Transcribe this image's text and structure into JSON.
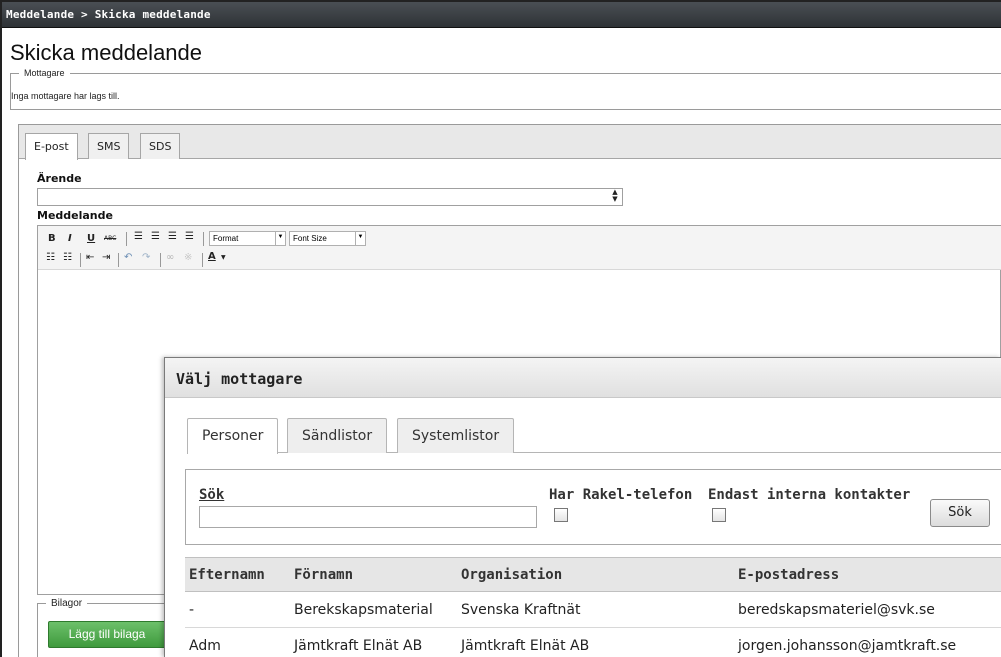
{
  "breadcrumb": "Meddelande > Skicka meddelande",
  "page_title": "Skicka meddelande",
  "recipients": {
    "legend": "Mottagare",
    "empty_text": "Inga mottagare har lags till."
  },
  "tabs": [
    {
      "label": "E-post"
    },
    {
      "label": "SMS"
    },
    {
      "label": "SDS"
    }
  ],
  "form": {
    "subject_label": "Ärende",
    "subject_value": "",
    "message_label": "Meddelande"
  },
  "toolbar": {
    "bold": "B",
    "italic": "I",
    "underline": "U",
    "strike": "ABC",
    "format_select": "Format",
    "font_size_select": "Font Size",
    "text_color": "A",
    "icons": [
      "bold-icon",
      "italic-icon",
      "underline-icon",
      "strikethrough-icon",
      "align-left-icon",
      "align-center-icon",
      "align-right-icon",
      "justify-icon",
      "bullet-list-icon",
      "numbered-list-icon",
      "outdent-icon",
      "indent-icon",
      "undo-icon",
      "redo-icon",
      "link-icon",
      "unlink-icon",
      "text-color-icon"
    ]
  },
  "attachments": {
    "legend": "Bilagor",
    "add_button": "Lägg till bilaga"
  },
  "modal": {
    "title": "Välj mottagare",
    "tabs": [
      {
        "label": "Personer"
      },
      {
        "label": "Sändlistor"
      },
      {
        "label": "Systemlistor"
      }
    ],
    "search": {
      "label": "Sök",
      "value": "",
      "rakel_label": "Har Rakel-telefon",
      "internal_label": "Endast interna kontakter",
      "button": "Sök"
    },
    "table": {
      "headers": [
        "Efternamn",
        "Förnamn",
        "Organisation",
        "E-postadress"
      ],
      "rows": [
        [
          "-",
          "Berekskapsmaterial",
          "Svenska Kraftnät",
          "beredskapsmateriel@svk.se"
        ],
        [
          "Adm",
          "Jämtkraft Elnät AB",
          "Jämtkraft Elnät AB",
          "jorgen.johansson@jamtkraft.se"
        ]
      ]
    }
  },
  "colors": {
    "titlebar": "#3a3f44",
    "attach_button": "#4caf50",
    "header_row": "#e6e6e6"
  }
}
